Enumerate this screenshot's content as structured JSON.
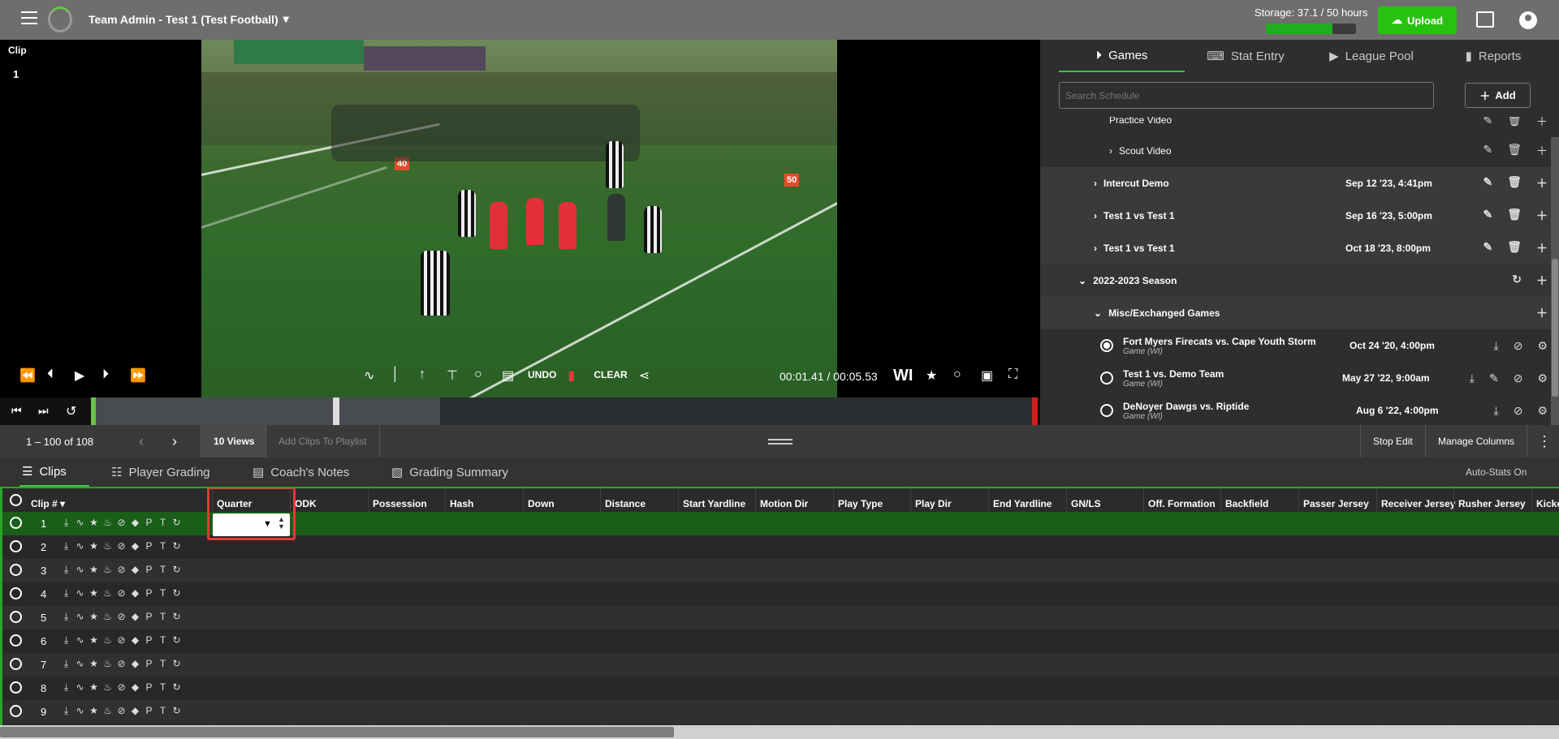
{
  "header": {
    "team_title": "Team Admin - Test 1 (Test Football)",
    "storage_text": "Storage: 37.1 / 50 hours",
    "storage_fraction": 0.742,
    "upload_label": "Upload"
  },
  "video": {
    "clip_label": "Clip",
    "clip_number": "1",
    "undo_label": "UNDO",
    "clear_label": "CLEAR",
    "time": "00:01.41 / 00:05.53",
    "wi_label": "WI"
  },
  "side": {
    "tabs": [
      {
        "label": "Games",
        "icon": "play-circle-icon"
      },
      {
        "label": "Stat Entry",
        "icon": "keyboard-icon"
      },
      {
        "label": "League Pool",
        "icon": "video-library-icon"
      },
      {
        "label": "Reports",
        "icon": "bar-chart-icon"
      }
    ],
    "search_placeholder": "Search Schedule",
    "add_label": "Add",
    "tree": [
      {
        "label": "Practice Video",
        "date": ""
      },
      {
        "label": "Scout Video",
        "date": ""
      },
      {
        "label": "Intercut Demo",
        "date": "Sep 12 '23, 4:41pm"
      },
      {
        "label": "Test 1 vs Test 1",
        "date": "Sep 16 '23, 5:00pm"
      },
      {
        "label": "Test 1 vs Test 1",
        "date": "Oct 18 '23, 8:00pm"
      },
      {
        "label": "2022-2023 Season",
        "date": ""
      },
      {
        "label": "Misc/Exchanged Games",
        "date": ""
      },
      {
        "label": "Fort Myers Firecats vs. Cape Youth Storm",
        "sub": "Game (WI)",
        "date": "Oct 24 '20, 4:00pm"
      },
      {
        "label": "Test 1 vs. Demo Team",
        "sub": "Game (WI)",
        "date": "May 27 '22, 9:00am"
      },
      {
        "label": "DeNoyer Dawgs vs. Riptide",
        "sub": "Game (WI)",
        "date": "Aug 6 '22, 4:00pm"
      }
    ]
  },
  "toolbar": {
    "range": "1 – 100 of 108",
    "views": "10 Views",
    "add_playlist": "Add Clips To Playlist",
    "stop_edit": "Stop Edit",
    "manage_columns": "Manage Columns"
  },
  "subtabs": {
    "clips": "Clips",
    "player_grading": "Player Grading",
    "coaches_notes": "Coach's Notes",
    "grading_summary": "Grading Summary",
    "auto_stats": "Auto-Stats On"
  },
  "grid": {
    "clip_header": "Clip #",
    "columns": [
      "Quarter",
      "ODK",
      "Possession",
      "Hash",
      "Down",
      "Distance",
      "Start Yardline",
      "Motion Dir",
      "Play Type",
      "Play Dir",
      "End Yardline",
      "GN/LS",
      "Off. Formation",
      "Backfield",
      "Passer Jersey",
      "Receiver Jersey",
      "Rusher Jersey",
      "Kicke"
    ],
    "rows": [
      "1",
      "2",
      "3",
      "4",
      "5",
      "6",
      "7",
      "8",
      "9"
    ],
    "row_icon_p": "P",
    "row_icon_t": "T"
  }
}
